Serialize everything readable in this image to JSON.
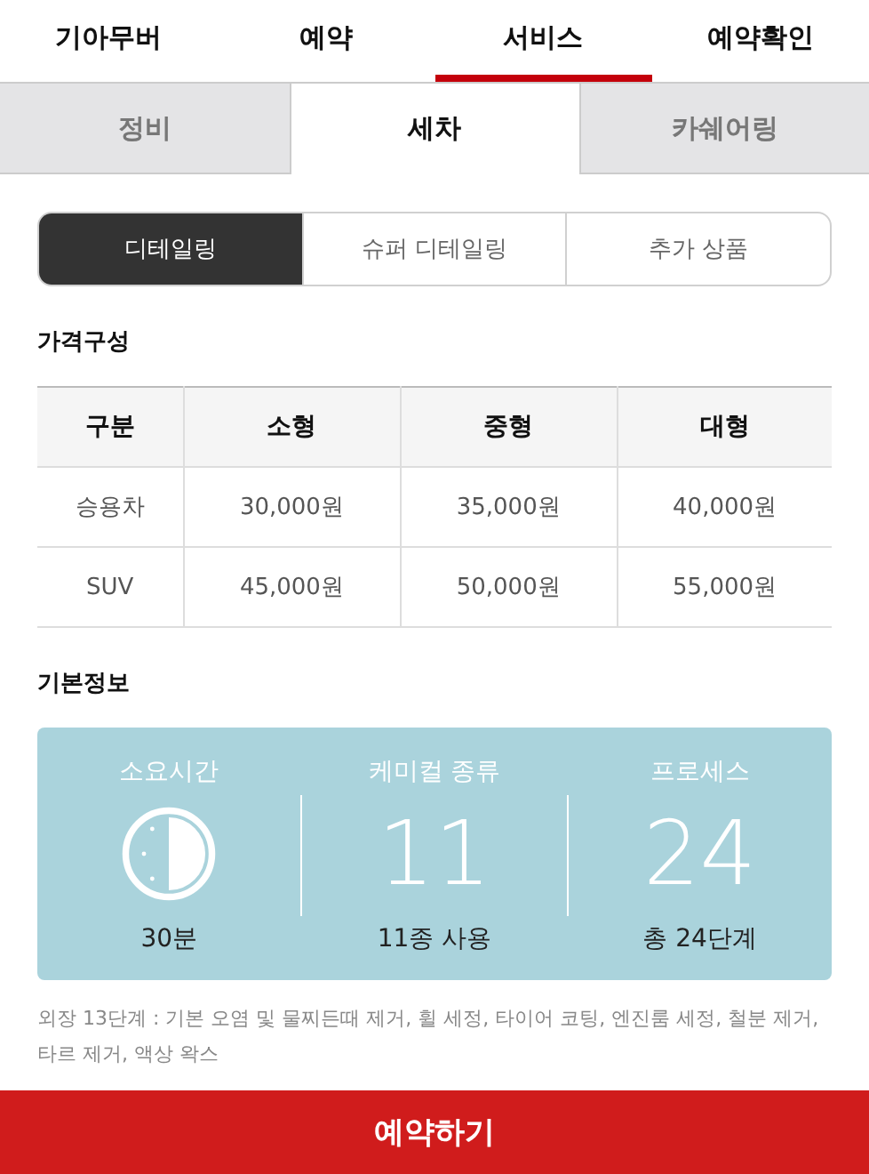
{
  "main_tabs": [
    {
      "label": "기아무버",
      "selected": false
    },
    {
      "label": "예약",
      "selected": false
    },
    {
      "label": "서비스",
      "selected": true
    },
    {
      "label": "예약확인",
      "selected": false
    }
  ],
  "sub_tabs": [
    {
      "label": "정비",
      "selected": false
    },
    {
      "label": "세차",
      "selected": true
    },
    {
      "label": "카쉐어링",
      "selected": false
    }
  ],
  "segments": [
    {
      "label": "디테일링",
      "selected": true
    },
    {
      "label": "슈퍼 디테일링",
      "selected": false
    },
    {
      "label": "추가 상품",
      "selected": false
    }
  ],
  "price_section": {
    "title": "가격구성",
    "columns": [
      "구분",
      "소형",
      "중형",
      "대형"
    ],
    "rows": [
      [
        "승용차",
        "30,000원",
        "35,000원",
        "40,000원"
      ],
      [
        "SUV",
        "45,000원",
        "50,000원",
        "55,000원"
      ]
    ]
  },
  "info_section": {
    "title": "기본정보",
    "items": [
      {
        "kind": "clock",
        "label": "소요시간",
        "caption": "30분"
      },
      {
        "kind": "number",
        "label": "케미컬 종류",
        "value": "11",
        "caption": "11종 사용"
      },
      {
        "kind": "number",
        "label": "프로세스",
        "value": "24",
        "caption": "총 24단계"
      }
    ]
  },
  "notes": [
    "외장 13단계 : 기본 오염 및 물찌든때 제거, 휠 세정, 타이어 코팅, 엔진룸 세정, 철분 제거, 타르 제거, 액상 왁스"
  ],
  "reserve_button": "예약하기"
}
